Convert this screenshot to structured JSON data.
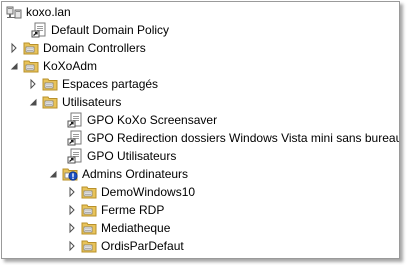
{
  "tree": {
    "root": {
      "label": "koxo.lan",
      "icon": "domain-icon",
      "expanded": true
    },
    "items": [
      {
        "label": "Default Domain Policy",
        "icon": "gpo-link-icon",
        "expander": "none"
      },
      {
        "label": "Domain Controllers",
        "icon": "ou-folder-icon",
        "expander": "collapsed"
      },
      {
        "label": "KoXoAdm",
        "icon": "ou-folder-icon",
        "expander": "expanded"
      },
      {
        "label": "Espaces partagés",
        "icon": "ou-folder-icon",
        "expander": "collapsed"
      },
      {
        "label": "Utilisateurs",
        "icon": "ou-folder-icon",
        "expander": "expanded"
      },
      {
        "label": "GPO KoXo Screensaver",
        "icon": "gpo-link-icon",
        "expander": "none"
      },
      {
        "label": "GPO Redirection dossiers Windows Vista mini sans bureau",
        "icon": "gpo-link-icon",
        "expander": "none"
      },
      {
        "label": "GPO Utilisateurs",
        "icon": "gpo-link-icon",
        "expander": "none"
      },
      {
        "label": "Admins Ordinateurs",
        "icon": "ou-folder-blocked-icon",
        "expander": "expanded"
      },
      {
        "label": "DemoWindows10",
        "icon": "ou-folder-icon",
        "expander": "collapsed"
      },
      {
        "label": "Ferme RDP",
        "icon": "ou-folder-icon",
        "expander": "collapsed"
      },
      {
        "label": "Mediatheque",
        "icon": "ou-folder-icon",
        "expander": "collapsed"
      },
      {
        "label": "OrdisParDefaut",
        "icon": "ou-folder-icon",
        "expander": "collapsed"
      }
    ]
  },
  "colors": {
    "folder": "#e8c35a",
    "folder_dark": "#b8902a",
    "expander": "#4d4d4d",
    "info_badge": "#1c4fc2",
    "border": "#9a9a9a"
  }
}
